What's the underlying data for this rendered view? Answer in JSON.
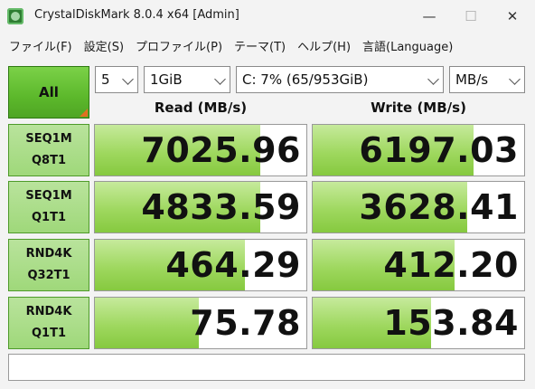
{
  "window": {
    "title": "CrystalDiskMark 8.0.4 x64 [Admin]",
    "min_glyph": "—",
    "max_glyph": "☐",
    "close_glyph": "✕"
  },
  "menu": [
    "ファイル(F)",
    "設定(S)",
    "プロファイル(P)",
    "テーマ(T)",
    "ヘルプ(H)",
    "言語(Language)"
  ],
  "controls": {
    "all_label": "All",
    "count": "5",
    "size": "1GiB",
    "drive": "C: 7% (65/953GiB)",
    "unit": "MB/s"
  },
  "headers": {
    "read": "Read (MB/s)",
    "write": "Write (MB/s)"
  },
  "rows": [
    {
      "line1": "SEQ1M",
      "line2": "Q8T1",
      "read": "7025.96",
      "write": "6197.03",
      "read_fill": 0.78,
      "write_fill": 0.76
    },
    {
      "line1": "SEQ1M",
      "line2": "Q1T1",
      "read": "4833.59",
      "write": "3628.41",
      "read_fill": 0.78,
      "write_fill": 0.73
    },
    {
      "line1": "RND4K",
      "line2": "Q32T1",
      "read": "464.29",
      "write": "412.20",
      "read_fill": 0.71,
      "write_fill": 0.67
    },
    {
      "line1": "RND4K",
      "line2": "Q1T1",
      "read": "75.78",
      "write": "153.84",
      "read_fill": 0.49,
      "write_fill": 0.56
    }
  ],
  "colors": {
    "accent_green": "#5cb82b",
    "bar_green": "#9fd85f",
    "corner_orange": "#e07020"
  }
}
